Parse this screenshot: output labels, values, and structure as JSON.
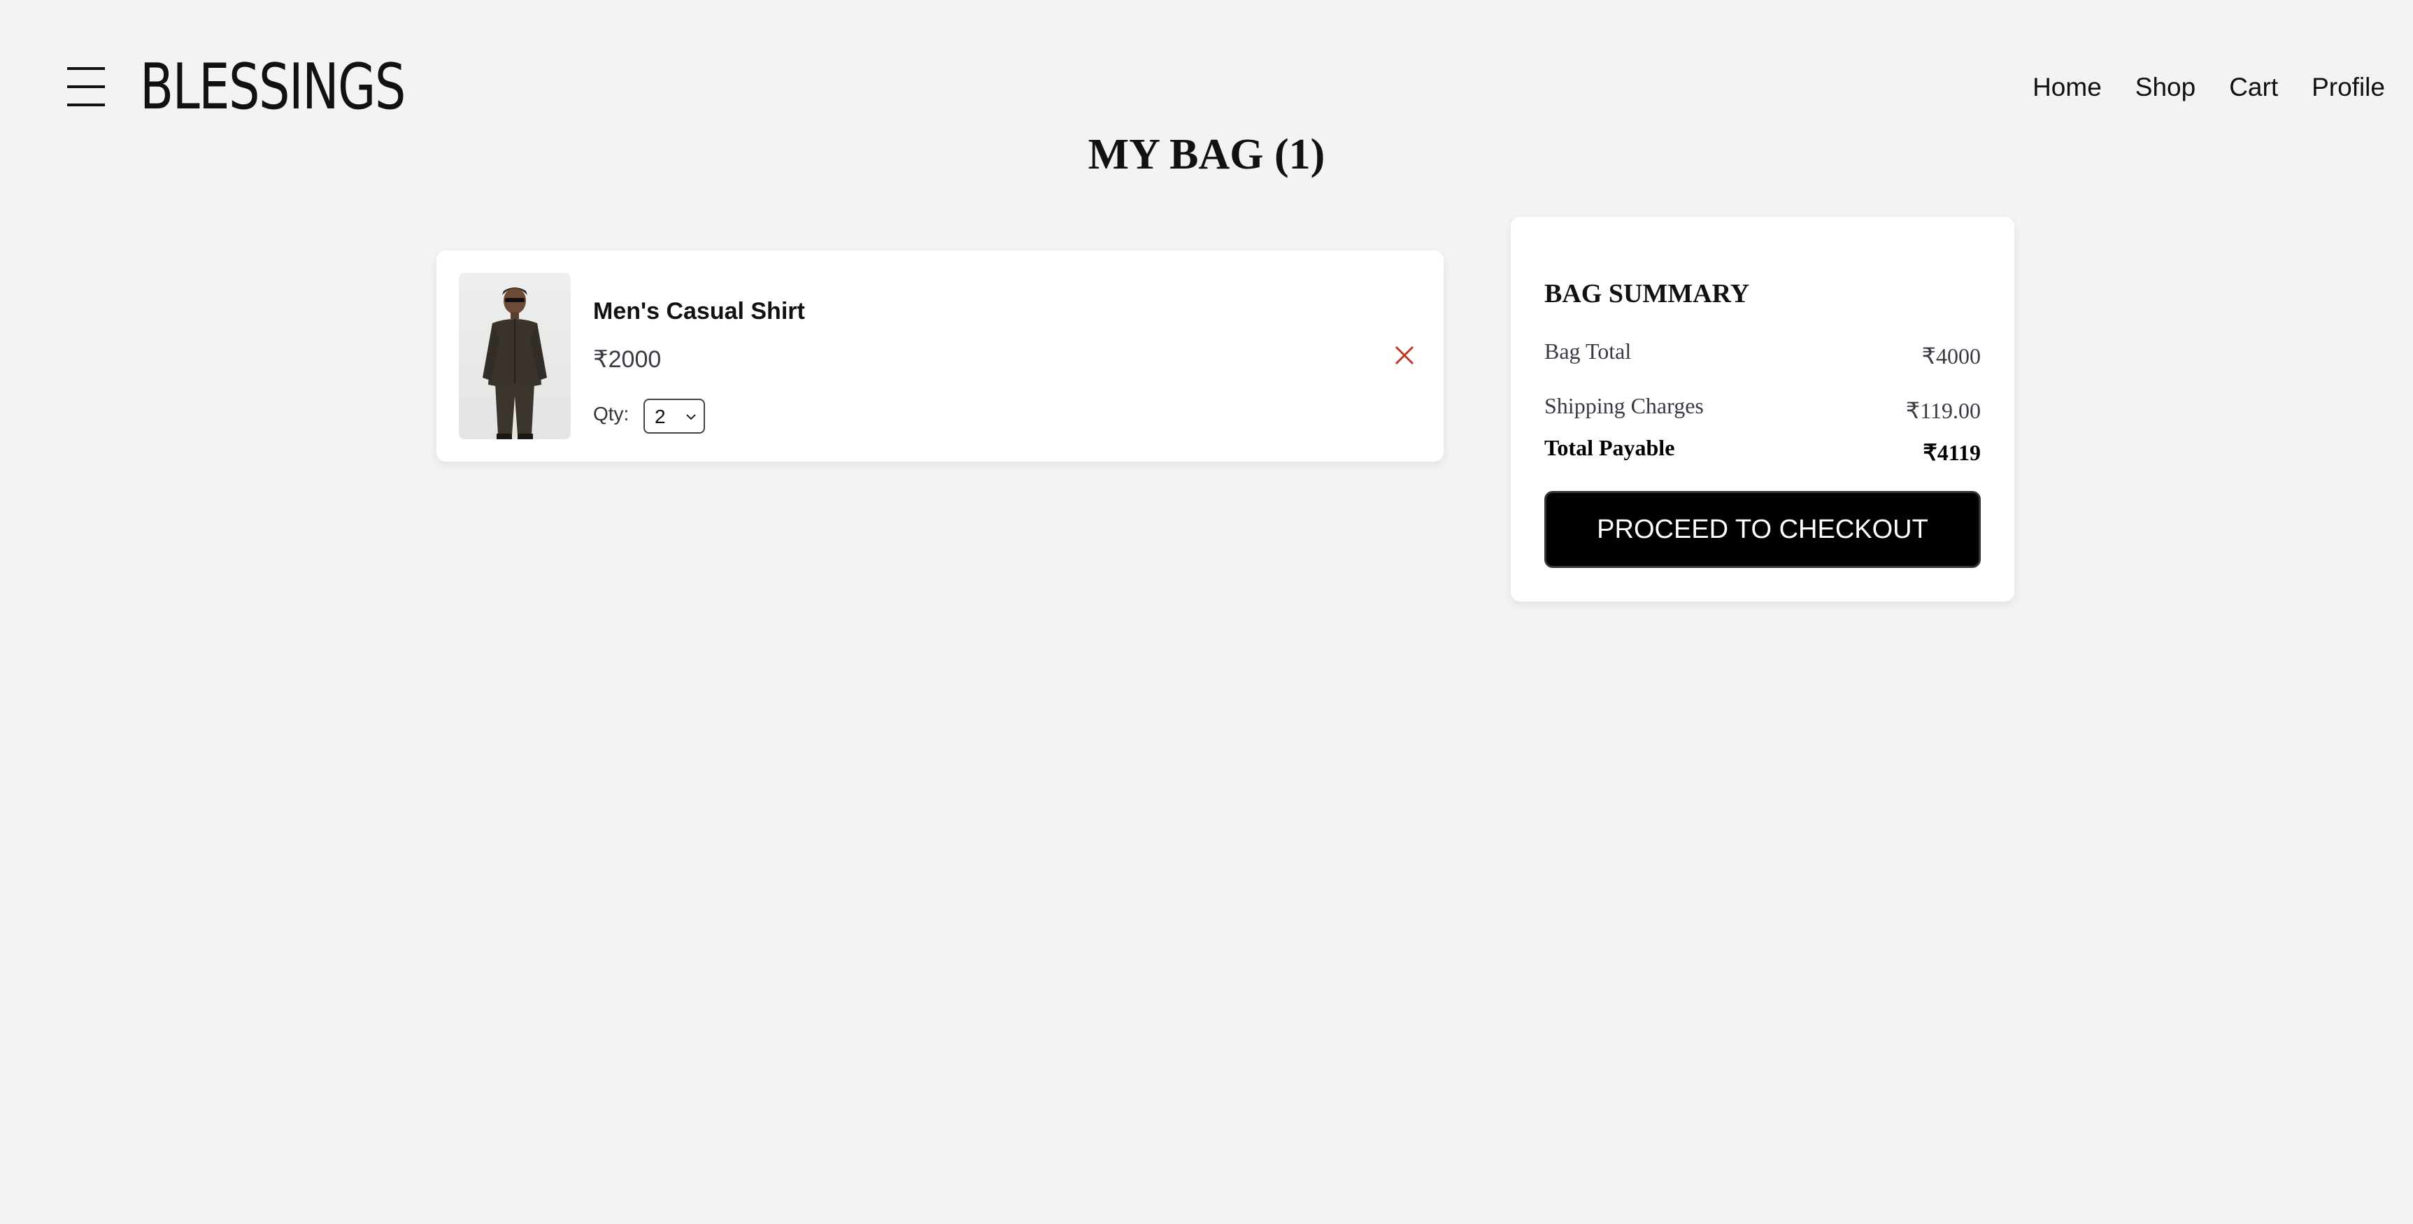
{
  "header": {
    "logo": "BLESSINGS",
    "nav": [
      "Home",
      "Shop",
      "Cart",
      "Profile"
    ]
  },
  "page": {
    "title": "MY BAG (1)"
  },
  "cart": {
    "items": [
      {
        "name": "Men's Casual Shirt",
        "price": "₹2000",
        "qty_label": "Qty:",
        "qty_value": "2"
      }
    ]
  },
  "summary": {
    "title": "BAG SUMMARY",
    "bag_total_label": "Bag Total",
    "bag_total_value": "₹4000",
    "shipping_label": "Shipping Charges",
    "shipping_value": "₹119.00",
    "total_label": "Total Payable",
    "total_value": "₹4119",
    "checkout_label": "PROCEED TO CHECKOUT"
  },
  "colors": {
    "background": "#f2f3f5",
    "button": "#000000",
    "remove": "#c0392b"
  }
}
